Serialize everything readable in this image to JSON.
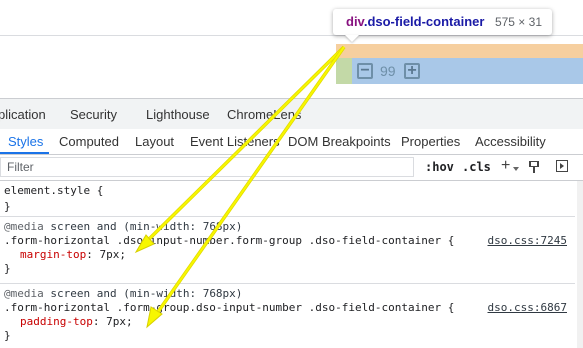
{
  "tooltip": {
    "tag": "div",
    "class_name": ".dso-field-container",
    "size": "575 × 31"
  },
  "preview": {
    "stepper_minus": "−",
    "stepper_value": "99",
    "stepper_plus": "+"
  },
  "panel_tabs": [
    "plication",
    "Security",
    "Lighthouse",
    "ChromeLens"
  ],
  "sidebar_tabs": [
    "Styles",
    "Computed",
    "Layout",
    "Event Listeners",
    "DOM Breakpoints",
    "Properties",
    "Accessibility"
  ],
  "filter": {
    "placeholder": "Filter",
    "hov": ":hov",
    "cls": ".cls"
  },
  "rules": {
    "element_style": {
      "selector": "element.style {",
      "close": "}"
    },
    "rule1": {
      "media_at": "@media",
      "media_query": " screen and (min-width: 768px)",
      "selector": ".form-horizontal .dso-input-number.form-group .dso-field-container {",
      "source": "dso.css:7245",
      "prop": "margin-top",
      "value": "7px;"
    },
    "rule2": {
      "media_at": "@media",
      "media_query": " screen and (min-width: 768px)",
      "selector": ".form-horizontal .form-group.dso-input-number .dso-field-container {",
      "source": "dso.css:6867",
      "prop": "padding-top",
      "value": "7px;"
    }
  },
  "colors": {
    "accent": "#1a73e8",
    "arrow": "#f7f700",
    "margin_highlight": "#f6cf9f",
    "padding_highlight": "#c3d9a7",
    "content_highlight": "#a9c8e8"
  }
}
